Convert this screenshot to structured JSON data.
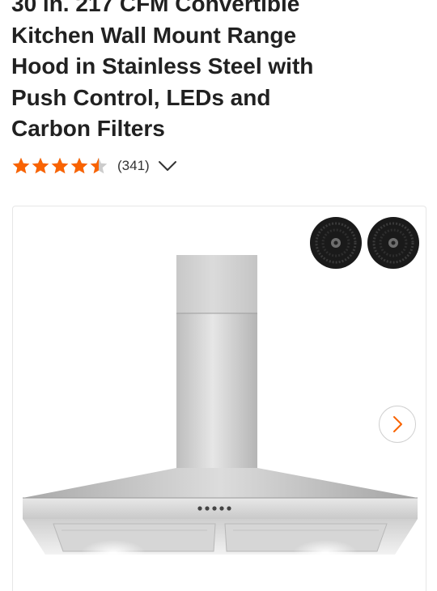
{
  "product": {
    "title_lines": [
      "30 in. 217 CFM Convertible",
      "Kitchen Wall Mount Range",
      "Hood in Stainless Steel with",
      "Push Control, LEDs and",
      "Carbon Filters"
    ],
    "rating": {
      "value": 4.5,
      "max": 5,
      "review_count_text": "(341)"
    },
    "image": {
      "subject": "stainless-steel-range-hood",
      "accessories": [
        "carbon-filter",
        "carbon-filter"
      ]
    }
  },
  "icons": {
    "star": "star-icon",
    "expand": "chevron-down-icon",
    "next": "chevron-right-icon"
  },
  "colors": {
    "star": "#f96302",
    "star_empty": "#cccccc",
    "next_arrow": "#f96302",
    "title_text": "#212121"
  }
}
